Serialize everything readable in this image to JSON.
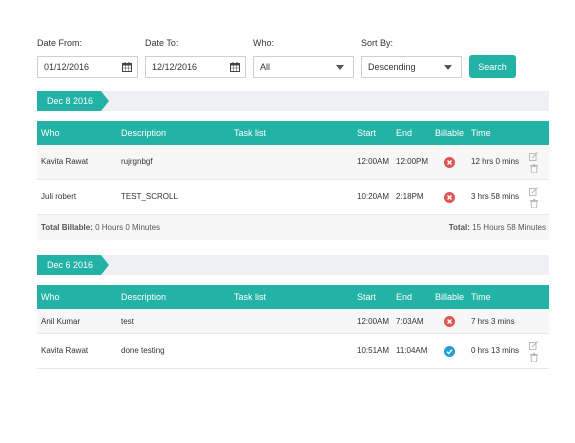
{
  "filters": {
    "date_from": {
      "label": "Date From:",
      "value": "01/12/2016"
    },
    "date_to": {
      "label": "Date To:",
      "value": "12/12/2016"
    },
    "who": {
      "label": "Who:",
      "value": "All"
    },
    "sort_by": {
      "label": "Sort By:",
      "value": "Descending"
    },
    "search_label": "Search"
  },
  "columns": [
    "Who",
    "Description",
    "Task list",
    "Start",
    "End",
    "Billable",
    "Time"
  ],
  "groups": [
    {
      "date": "Dec 8 2016",
      "rows": [
        {
          "who": "Kavita Rawat",
          "description": "rujrgnbgf",
          "task": "",
          "start": "12:00AM",
          "end": "12:00PM",
          "billable": false,
          "time": "12 hrs 0 mins"
        },
        {
          "who": "Juli robert",
          "description": "TEST_SCROLL",
          "task": "",
          "start": "10:20AM",
          "end": "2:18PM",
          "billable": false,
          "time": "3 hrs 58 mins"
        }
      ],
      "total_billable_label": "Total Billable:",
      "total_billable_value": "0 Hours 0 Minutes",
      "total_label": "Total:",
      "total_value": "15 Hours 58 Minutes"
    },
    {
      "date": "Dec 6 2016",
      "rows": [
        {
          "who": "Anil Kumar",
          "description": "test",
          "task": "",
          "start": "12:00AM",
          "end": "7:03AM",
          "billable": false,
          "time": "7 hrs 3 mins"
        },
        {
          "who": "Kavita Rawat",
          "description": "done testing",
          "task": "",
          "start": "10:51AM",
          "end": "11:04AM",
          "billable": true,
          "time": "0 hrs 13 mins"
        }
      ]
    }
  ],
  "colors": {
    "accent": "#23b2a6",
    "not_billable": "#e05454",
    "billable": "#1e9fd6"
  }
}
